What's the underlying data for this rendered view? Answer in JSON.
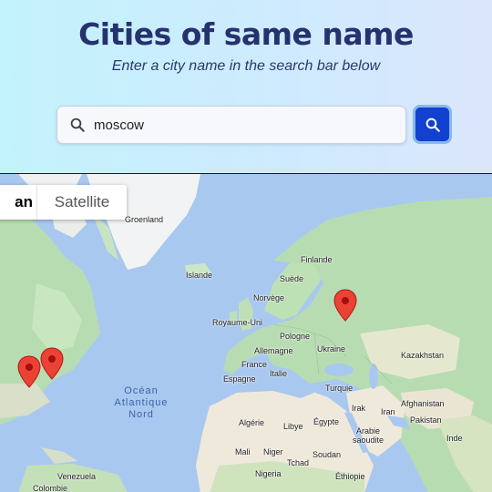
{
  "header": {
    "title": "Cities of same name",
    "subtitle": "Enter a city name in the search bar below"
  },
  "search": {
    "value": "moscow",
    "icon": "search-icon",
    "button_icon": "search-icon"
  },
  "map": {
    "map_type_buttons": [
      "an",
      "Satellite"
    ],
    "labels": {
      "groenland": "Groenland",
      "islande": "Islande",
      "finlande": "Finlande",
      "suede": "Suède",
      "norvege": "Norvège",
      "royaume_uni": "Royaume-Uni",
      "pologne": "Pologne",
      "allemagne": "Allemagne",
      "ukraine": "Ukraine",
      "france": "France",
      "kazakhstan": "Kazakhstan",
      "italie": "Italie",
      "espagne": "Espagne",
      "turquie": "Turquie",
      "irak": "Irak",
      "iran": "Iran",
      "afghanistan": "Afghanistan",
      "pakistan": "Pakistan",
      "algerie": "Algérie",
      "libye": "Libye",
      "egypte": "Égypte",
      "arabie_saoudite": "Arabie\nsaoudite",
      "inde": "Inde",
      "mali": "Mali",
      "niger": "Niger",
      "tchad": "Tchad",
      "soudan": "Soudan",
      "nigeria": "Nigeria",
      "ethiopie": "Éthiopie",
      "venezuela": "Venezuela",
      "colombie": "Colombie",
      "ocean_line1": "Océan",
      "ocean_line2": "Atlantique",
      "ocean_line3": "Nord"
    },
    "colors": {
      "water": "#a9c8ef",
      "land": "#b8dcb2",
      "desert": "#efe9dc",
      "marker": "#ea4335"
    }
  }
}
